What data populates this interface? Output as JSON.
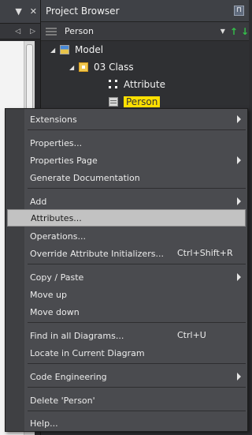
{
  "left_pane": {
    "dropdown_glyph": "▼",
    "close_glyph": "✕",
    "nav_left_glyph": "◁",
    "nav_right_glyph": "▷"
  },
  "browser": {
    "title": "Project Browser",
    "pin_glyph": "⊓",
    "selector": "Person",
    "tree": {
      "model": "Model",
      "package": "03 Class",
      "attribute": "Attribute",
      "selected_class": "Person"
    }
  },
  "menu": {
    "extensions": "Extensions",
    "properties": "Properties...",
    "properties_page": "Properties Page",
    "generate_documentation": "Generate Documentation",
    "add": "Add",
    "attributes": "Attributes...",
    "operations": "Operations...",
    "override_initializers": "Override Attribute Initializers...",
    "override_initializers_shortcut": "Ctrl+Shift+R",
    "copy_paste": "Copy / Paste",
    "move_up": "Move up",
    "move_down": "Move down",
    "find_in_diagrams": "Find in all Diagrams...",
    "find_in_diagrams_shortcut": "Ctrl+U",
    "locate_in_diagram": "Locate in Current Diagram",
    "code_engineering": "Code Engineering",
    "delete": "Delete 'Person'",
    "help": "Help..."
  },
  "colors": {
    "highlight": "#c2c2c2",
    "selection_yellow": "#ffe000",
    "green_arrow": "#34c04a"
  }
}
